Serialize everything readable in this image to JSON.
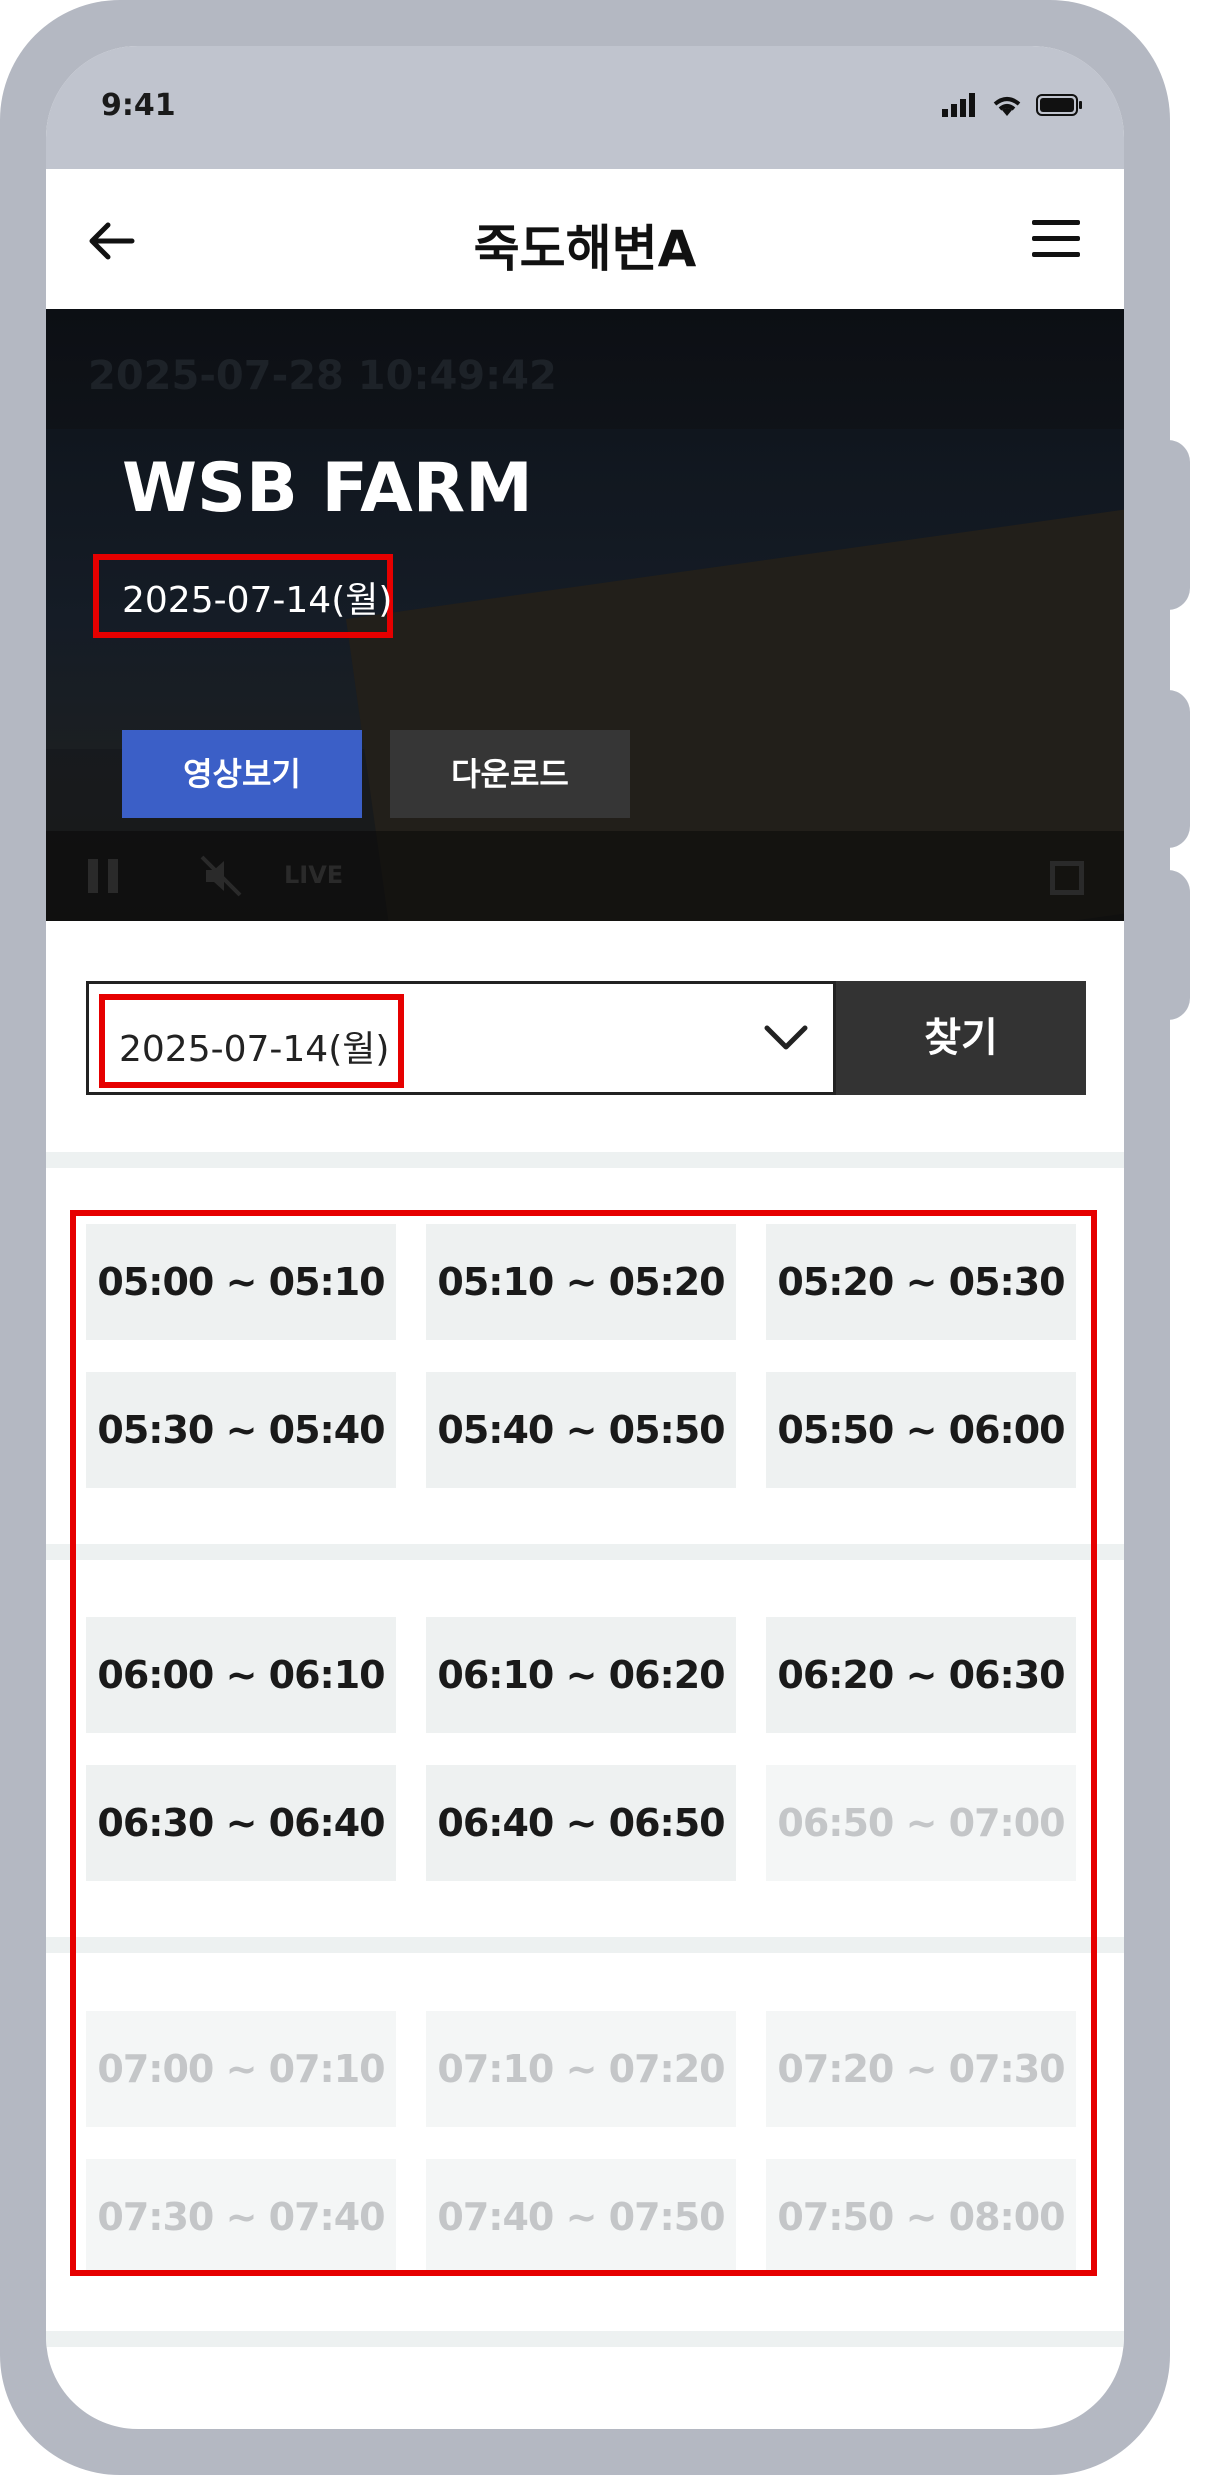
{
  "status": {
    "time": "9:41"
  },
  "nav": {
    "title": "죽도해변A"
  },
  "video": {
    "timestamp": "2025-07-28 10:49:42",
    "title": "WSB FARM",
    "date": "2025-07-14(월)",
    "watch_label": "영상보기",
    "download_label": "다운로드",
    "live_label": "LIVE"
  },
  "search": {
    "date_value": "2025-07-14(월)",
    "button_label": "찾기"
  },
  "slot_groups": [
    {
      "slots": [
        {
          "label": "05:00 ~ 05:10",
          "enabled": true
        },
        {
          "label": "05:10 ~ 05:20",
          "enabled": true
        },
        {
          "label": "05:20 ~ 05:30",
          "enabled": true
        },
        {
          "label": "05:30 ~ 05:40",
          "enabled": true
        },
        {
          "label": "05:40 ~ 05:50",
          "enabled": true
        },
        {
          "label": "05:50 ~ 06:00",
          "enabled": true
        }
      ]
    },
    {
      "slots": [
        {
          "label": "06:00 ~ 06:10",
          "enabled": true
        },
        {
          "label": "06:10 ~ 06:20",
          "enabled": true
        },
        {
          "label": "06:20 ~ 06:30",
          "enabled": true
        },
        {
          "label": "06:30 ~ 06:40",
          "enabled": true
        },
        {
          "label": "06:40 ~ 06:50",
          "enabled": true
        },
        {
          "label": "06:50 ~ 07:00",
          "enabled": false
        }
      ]
    },
    {
      "slots": [
        {
          "label": "07:00 ~ 07:10",
          "enabled": false
        },
        {
          "label": "07:10 ~ 07:20",
          "enabled": false
        },
        {
          "label": "07:20 ~ 07:30",
          "enabled": false
        },
        {
          "label": "07:30 ~ 07:40",
          "enabled": false
        },
        {
          "label": "07:40 ~ 07:50",
          "enabled": false
        },
        {
          "label": "07:50 ~ 08:00",
          "enabled": false
        }
      ]
    }
  ],
  "colors": {
    "accent_blue": "#3b5fc7",
    "dark_button": "#333333",
    "highlight_red": "#e60000",
    "slot_bg": "#eef1f1",
    "slot_disabled_text": "#c4c6c8"
  },
  "icons": [
    "back-arrow-icon",
    "hamburger-menu-icon",
    "signal-icon",
    "wifi-icon",
    "battery-icon",
    "chevron-down-icon",
    "pause-icon",
    "mute-icon",
    "fullscreen-icon"
  ]
}
